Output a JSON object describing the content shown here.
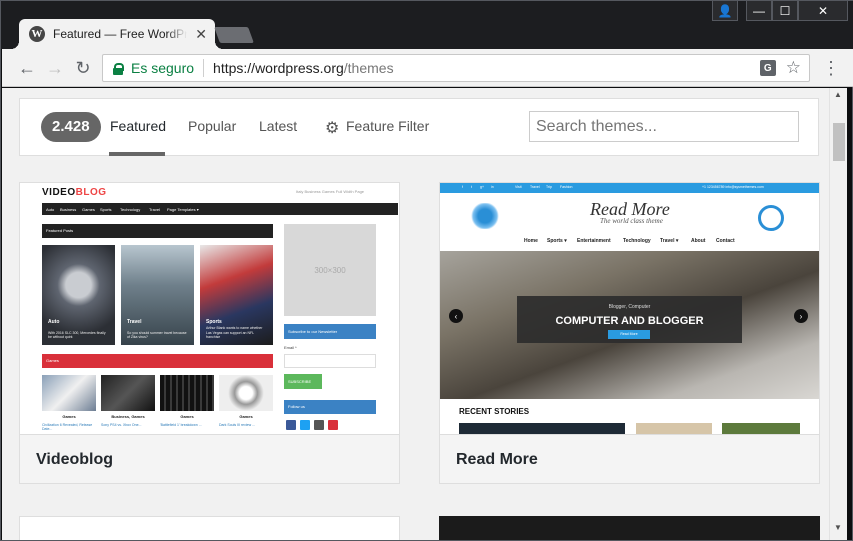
{
  "browser": {
    "tab_title": "Free WordPress Themes",
    "tab_title_visible": "Featured — Free WordPr",
    "favicon_letter": "W",
    "close_glyph": "✕",
    "controls": {
      "user": "👤",
      "minimize": "—",
      "maximize": "☐",
      "close": "✕"
    },
    "nav": {
      "back": "←",
      "forward": "→",
      "reload": "↻",
      "menu": "⋮"
    },
    "secure_label": "Es seguro",
    "url_host": "https://wordpress.org",
    "url_path": "/themes",
    "translate_glyph": "G",
    "star_glyph": "☆"
  },
  "filterbar": {
    "count": "2.428",
    "tabs": [
      {
        "label": "Featured",
        "active": true
      },
      {
        "label": "Popular",
        "active": false
      },
      {
        "label": "Latest",
        "active": false
      },
      {
        "label": "Feature Filter",
        "active": false
      }
    ],
    "search_placeholder": "Search themes..."
  },
  "themes": [
    {
      "name": "Videoblog",
      "preview": {
        "logo_a": "VIDEO",
        "logo_b": "BLOG",
        "top_links": "Italy   Business   Games   Full Width Page",
        "nav": [
          "Auto",
          "Business",
          "Games",
          "Sports",
          "Technology",
          "Travel",
          "Page Templates ▾"
        ],
        "featured_label": "Featured Posts",
        "tiles": [
          {
            "label": "Auto",
            "caption": "With 2016 SLC 300, Mercedes finally be without quirk"
          },
          {
            "label": "Travel",
            "caption": "So you should summer travel because of Zika virus?"
          },
          {
            "label": "Sports",
            "caption": "Arthur Blank wants to name whether Las Vegas can support an NFL franchise"
          }
        ],
        "games_label": "Games",
        "thumbs": [
          {
            "label": "Games",
            "caption": "Civilization 6 Revealed, Release Date..."
          },
          {
            "label": "Business, Games",
            "caption": "Sony PS4 vs. Xbox One..."
          },
          {
            "label": "Games",
            "caption": "'Battlefield 1' breakdown ..."
          },
          {
            "label": "Games",
            "caption": "Dark Souls III review ..."
          }
        ],
        "ad_label": "300×300",
        "subscribe_label": "Subscribe to our Newsletter",
        "email_label": "Email *",
        "subscribe_button": "SUBSCRIBE",
        "follow_label": "Follow us"
      }
    },
    {
      "name": "Read More",
      "preview": {
        "top_links": [
          "f",
          "t",
          "g+",
          "in"
        ],
        "top_menu": [
          "Visit",
          "Travel",
          "Trip",
          "Fashion"
        ],
        "top_contact": "+1 123456789    info@sysmethemes.com",
        "logo": "Read More",
        "tagline": "The world class theme",
        "nav": [
          "Home",
          "Sports ▾",
          "Entertainment",
          "Technology",
          "Travel ▾",
          "About",
          "Contact"
        ],
        "hero_sub": "Blogger, Computer",
        "hero_title": "COMPUTER AND BLOGGER",
        "hero_button": "Read More",
        "recent_label": "RECENT STORIES",
        "prev_arrow": "‹",
        "next_arrow": "›"
      }
    }
  ],
  "colors": {
    "accent_blue": "#2a9be0",
    "secure_green": "#0b8043",
    "count_badge": "#666666"
  }
}
